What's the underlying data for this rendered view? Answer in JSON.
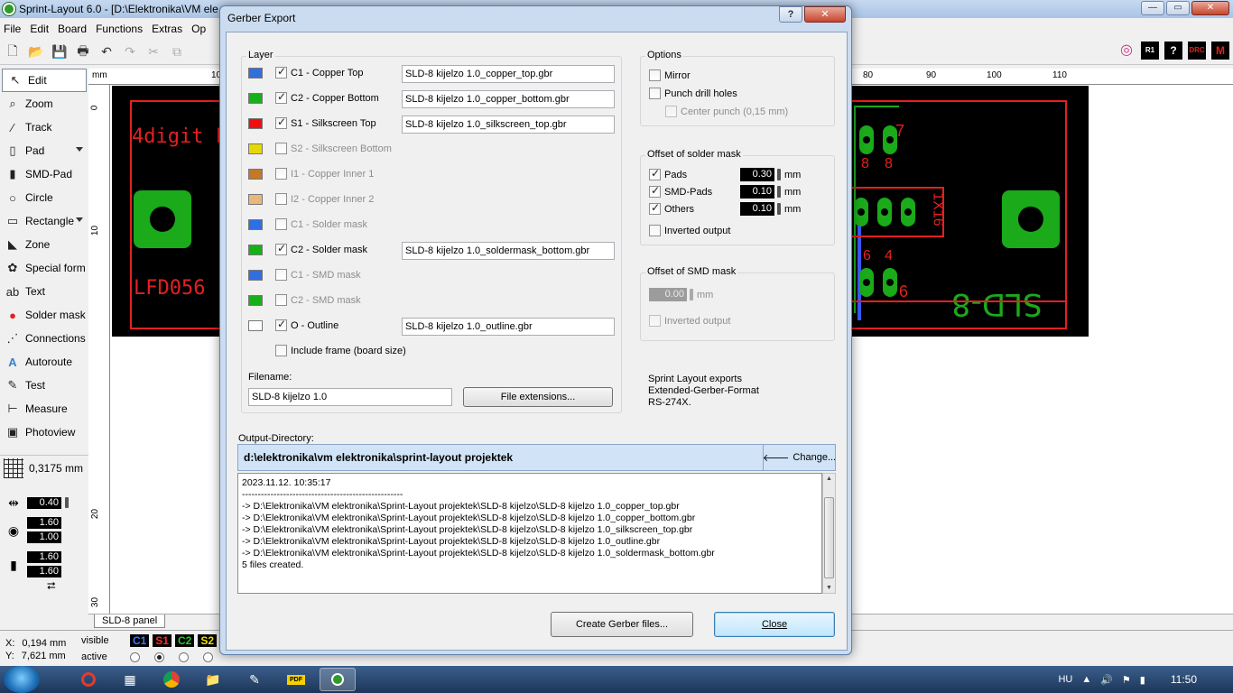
{
  "app": {
    "title": "Sprint-Layout 6.0 - [D:\\Elektronika\\VM ele",
    "menu": [
      "File",
      "Edit",
      "Board",
      "Functions",
      "Extras",
      "Op"
    ],
    "right_tools": [
      "R1",
      "DRC"
    ]
  },
  "tools": [
    {
      "label": "Edit",
      "icon": "cursor-icon"
    },
    {
      "label": "Zoom",
      "icon": "magnifier-icon"
    },
    {
      "label": "Track",
      "icon": "track-icon"
    },
    {
      "label": "Pad",
      "icon": "pad-icon"
    },
    {
      "label": "SMD-Pad",
      "icon": "smd-pad-icon"
    },
    {
      "label": "Circle",
      "icon": "circle-icon"
    },
    {
      "label": "Rectangle",
      "icon": "rectangle-icon"
    },
    {
      "label": "Zone",
      "icon": "zone-icon"
    },
    {
      "label": "Special form",
      "icon": "special-form-icon"
    },
    {
      "label": "Text",
      "icon": "text-icon"
    },
    {
      "label": "Solder mask",
      "icon": "solder-mask-icon"
    },
    {
      "label": "Connections",
      "icon": "connections-icon"
    },
    {
      "label": "Autoroute",
      "icon": "autoroute-icon"
    },
    {
      "label": "Test",
      "icon": "test-icon"
    },
    {
      "label": "Measure",
      "icon": "measure-icon"
    },
    {
      "label": "Photoview",
      "icon": "photoview-icon"
    }
  ],
  "grid": {
    "value": "0,3175 mm"
  },
  "track_width": "0.40",
  "pad_size": [
    "1.60",
    "1.00"
  ],
  "smd_size": [
    "1.60",
    "1.60"
  ],
  "ruler": {
    "unit": "mm",
    "top_ticks": [
      "10",
      "80",
      "90",
      "100",
      "110"
    ],
    "left_ticks": [
      "0",
      "10",
      "20",
      "30"
    ]
  },
  "board": {
    "red_texts": [
      "4digit LE",
      "LFD056"
    ],
    "silk_right": [
      "7",
      "8",
      "8",
      "1X16",
      "6",
      "4",
      "6"
    ],
    "bottom_text": "SLD-8"
  },
  "panel_tab": "SLD-8 panel",
  "status": {
    "x_label": "X:",
    "x_value": "0,194 mm",
    "y_label": "Y:",
    "y_value": "7,621 mm",
    "visible_label": "visible",
    "active_label": "active",
    "layer_tags": [
      {
        "name": "C1",
        "color": "#3a78ff"
      },
      {
        "name": "S1",
        "color": "#ff2a2a"
      },
      {
        "name": "C2",
        "color": "#22cc22"
      },
      {
        "name": "S2",
        "color": "#f2e400"
      }
    ]
  },
  "taskbar": {
    "lang": "HU",
    "time": "11:50"
  },
  "dialog": {
    "title": "Gerber Export",
    "layer_group": "Layer",
    "layers": [
      {
        "color": "#2f6fe0",
        "checked": true,
        "enabled": true,
        "label": "C1 - Copper Top",
        "file": "SLD-8 kijelzo 1.0_copper_top.gbr"
      },
      {
        "color": "#18b018",
        "checked": true,
        "enabled": true,
        "label": "C2 - Copper Bottom",
        "file": "SLD-8 kijelzo 1.0_copper_bottom.gbr"
      },
      {
        "color": "#ee1010",
        "checked": true,
        "enabled": true,
        "label": "S1 - Silkscreen Top",
        "file": "SLD-8 kijelzo 1.0_silkscreen_top.gbr"
      },
      {
        "color": "#e6d800",
        "checked": false,
        "enabled": false,
        "label": "S2 - Silkscreen Bottom",
        "file": ""
      },
      {
        "color": "#c07a28",
        "checked": false,
        "enabled": false,
        "label": "I1 - Copper Inner 1",
        "file": ""
      },
      {
        "color": "#e8b77a",
        "checked": false,
        "enabled": false,
        "label": "I2 - Copper Inner 2",
        "file": ""
      },
      {
        "color": "#2f6fe0",
        "checked": false,
        "enabled": false,
        "label": "C1 - Solder mask",
        "file": ""
      },
      {
        "color": "#18b018",
        "checked": true,
        "enabled": true,
        "label": "C2 - Solder mask",
        "file": "SLD-8 kijelzo 1.0_soldermask_bottom.gbr"
      },
      {
        "color": "#2f6fe0",
        "checked": false,
        "enabled": false,
        "label": "C1 - SMD mask",
        "file": ""
      },
      {
        "color": "#18b018",
        "checked": false,
        "enabled": false,
        "label": "C2 - SMD mask",
        "file": ""
      },
      {
        "color": "#ffffff",
        "checked": true,
        "enabled": true,
        "label": "O - Outline",
        "file": "SLD-8 kijelzo 1.0_outline.gbr"
      }
    ],
    "include_frame": {
      "label": "Include frame (board size)",
      "checked": false
    },
    "filename_label": "Filename:",
    "filename_value": "SLD-8 kijelzo 1.0",
    "file_ext_button": "File extensions...",
    "options": {
      "title": "Options",
      "mirror": {
        "label": "Mirror",
        "checked": false
      },
      "punch": {
        "label": "Punch drill holes",
        "checked": false
      },
      "center_punch": {
        "label": "Center punch (0,15 mm)",
        "checked": false
      }
    },
    "solder_offset": {
      "title": "Offset of solder mask",
      "rows": [
        {
          "label": "Pads",
          "checked": true,
          "value": "0.30",
          "unit": "mm"
        },
        {
          "label": "SMD-Pads",
          "checked": true,
          "value": "0.10",
          "unit": "mm"
        },
        {
          "label": "Others",
          "checked": true,
          "value": "0.10",
          "unit": "mm"
        }
      ],
      "inverted": {
        "label": "Inverted output",
        "checked": false
      }
    },
    "smd_offset": {
      "title": "Offset of SMD mask",
      "value": "0.00",
      "unit": "mm",
      "inverted": {
        "label": "Inverted output",
        "checked": false
      }
    },
    "info": [
      "Sprint Layout exports",
      "Extended-Gerber-Format",
      "RS-274X."
    ],
    "output_label": "Output-Directory:",
    "output_path": "d:\\elektronika\\vm elektronika\\sprint-layout projektek",
    "change_button": "Change...",
    "log": "2023.11.12. 10:35:17\n---------------------------------------------------\n-> D:\\Elektronika\\VM elektronika\\Sprint-Layout projektek\\SLD-8 kijelzo\\SLD-8 kijelzo 1.0_copper_top.gbr\n-> D:\\Elektronika\\VM elektronika\\Sprint-Layout projektek\\SLD-8 kijelzo\\SLD-8 kijelzo 1.0_copper_bottom.gbr\n-> D:\\Elektronika\\VM elektronika\\Sprint-Layout projektek\\SLD-8 kijelzo\\SLD-8 kijelzo 1.0_silkscreen_top.gbr\n-> D:\\Elektronika\\VM elektronika\\Sprint-Layout projektek\\SLD-8 kijelzo\\SLD-8 kijelzo 1.0_outline.gbr\n-> D:\\Elektronika\\VM elektronika\\Sprint-Layout projektek\\SLD-8 kijelzo\\SLD-8 kijelzo 1.0_soldermask_bottom.gbr\n5 files created.",
    "create_button": "Create Gerber files...",
    "close_button": "Close"
  }
}
